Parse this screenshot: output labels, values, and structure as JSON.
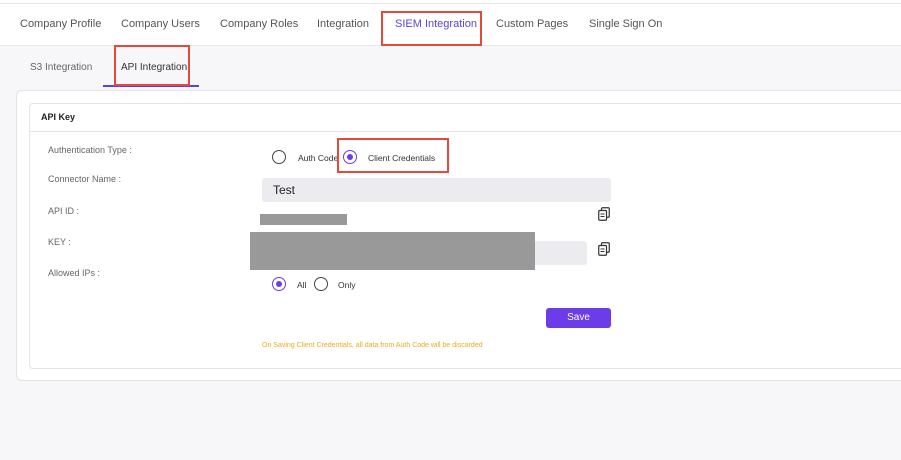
{
  "main_tabs": [
    {
      "label": "Company Profile"
    },
    {
      "label": "Company Users"
    },
    {
      "label": "Company Roles"
    },
    {
      "label": "Integration"
    },
    {
      "label": "SIEM Integration"
    },
    {
      "label": "Custom Pages"
    },
    {
      "label": "Single Sign On"
    }
  ],
  "active_main_tab": "SIEM Integration",
  "sub_tabs": [
    {
      "label": "S3 Integration"
    },
    {
      "label": "API Integration"
    }
  ],
  "active_sub_tab": "API Integration",
  "section": {
    "title": "API Key"
  },
  "form": {
    "auth_type_label": "Authentication Type :",
    "auth_options": [
      "Auth Code",
      "Client Credentials"
    ],
    "auth_selected": "Client Credentials",
    "connector_label": "Connector Name :",
    "connector_value": "Test",
    "api_id_label": "API ID :",
    "key_label": "KEY :",
    "allowed_ips_label": "Allowed IPs :",
    "ip_options": [
      "All",
      "Only"
    ],
    "ip_selected": "All",
    "save_label": "Save",
    "warning": "On Saving Client Credentials, all data from Auth Code will be discarded"
  },
  "colors": {
    "accent": "#6a3de8",
    "highlight_box": "#e24a3b",
    "warning": "#f2a81d",
    "masked": "#999999"
  },
  "icons": {
    "copy": "copy-icon"
  }
}
